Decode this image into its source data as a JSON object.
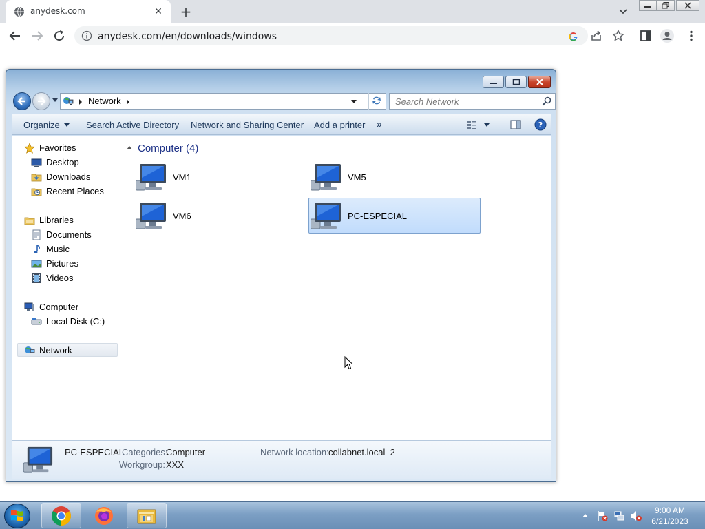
{
  "browser": {
    "tab_title": "anydesk.com",
    "url": "anydesk.com/en/downloads/windows"
  },
  "explorer": {
    "breadcrumb": "Network",
    "search_placeholder": "Search Network",
    "commands": {
      "organize": "Organize",
      "search_ad": "Search Active Directory",
      "network_sharing": "Network and Sharing Center",
      "add_printer": "Add a printer",
      "more": "»"
    },
    "nav": {
      "favorites": "Favorites",
      "desktop": "Desktop",
      "downloads": "Downloads",
      "recent_places": "Recent Places",
      "libraries": "Libraries",
      "documents": "Documents",
      "music": "Music",
      "pictures": "Pictures",
      "videos": "Videos",
      "computer": "Computer",
      "local_disk": "Local Disk (C:)",
      "network": "Network"
    },
    "group_header": "Computer (4)",
    "items": [
      {
        "name": "VM1",
        "selected": false
      },
      {
        "name": "VM5",
        "selected": false
      },
      {
        "name": "VM6",
        "selected": false
      },
      {
        "name": "PC-ESPECIAL",
        "selected": true
      }
    ],
    "details": {
      "name": "PC-ESPECIAL",
      "categories_label": "Categories:",
      "categories_value": "Computer",
      "workgroup_label": "Workgroup:",
      "workgroup_value": "XXX",
      "location_label": "Network location:",
      "location_value": "collabnet.local  2"
    }
  },
  "taskbar": {
    "time": "9:00 AM",
    "date": "6/21/2023"
  },
  "colors": {
    "accent": "#1e3287",
    "selection": "#c1dcfc",
    "taskbar": "#7c9fc4"
  }
}
